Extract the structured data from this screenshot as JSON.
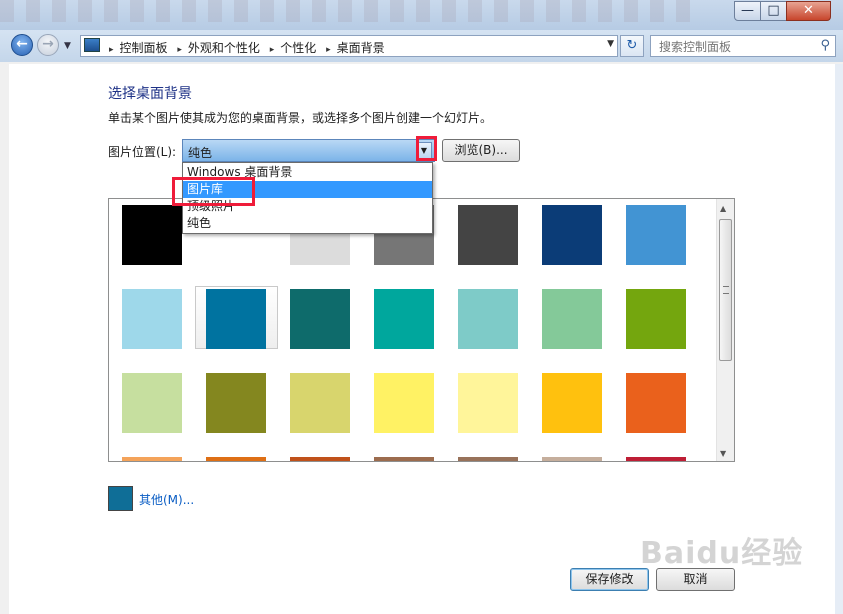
{
  "window": {
    "min_glyph": "—",
    "max_glyph": "□",
    "close_glyph": "✕"
  },
  "nav": {
    "back_glyph": "←",
    "forward_glyph": "→",
    "breadcrumbs": [
      "控制面板",
      "外观和个性化",
      "个性化",
      "桌面背景"
    ],
    "breadcrumb_sep": "▸",
    "refresh_glyph": "↻",
    "search_placeholder": "搜索控制面板",
    "search_icon": "search-icon"
  },
  "page": {
    "heading": "选择桌面背景",
    "description": "单击某个图片使其成为您的桌面背景，或选择多个图片创建一个幻灯片。",
    "location_label": "图片位置(L):",
    "location_value": "纯色",
    "browse_label": "浏览(B)..."
  },
  "dropdown": {
    "options": [
      "Windows 桌面背景",
      "图片库",
      "顶级照片",
      "纯色"
    ],
    "highlighted_index": 1
  },
  "swatches": {
    "selected_index": 5,
    "colors": [
      "#000000",
      "#ffffff",
      "#dcdcdc",
      "#767676",
      "#444444",
      "#0b3c77",
      "#4294d3",
      "#9ed8ea",
      "#0073a0",
      "#0e6b6b",
      "#00a79d",
      "#7ecbc8",
      "#84c999",
      "#74a60e",
      "#c6df9f",
      "#84871f",
      "#d8d56d",
      "#fff264",
      "#fff59a",
      "#ffc10e",
      "#ea611c",
      "#f4a35a",
      "#de6f15",
      "#c0511a",
      "#9c6c4e",
      "#98725a",
      "#c5ae9c",
      "#be1e35"
    ]
  },
  "other": {
    "swatch_color": "#0f6e97",
    "link_label": "其他(M)..."
  },
  "footer": {
    "save_label": "保存修改",
    "cancel_label": "取消"
  },
  "watermark": {
    "text": "Baidu经验"
  }
}
